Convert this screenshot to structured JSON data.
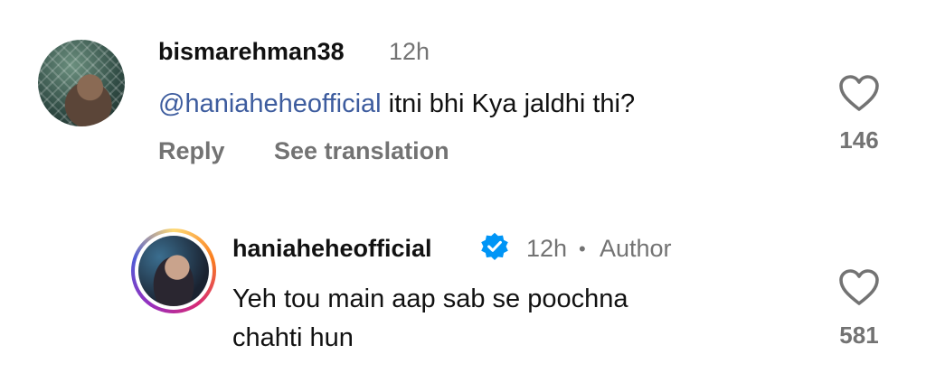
{
  "comment1": {
    "username": "bismarehman38",
    "time": "12h",
    "mention": "@haniaheheofficial",
    "text": "itni bhi Kya jaldhi thi?",
    "reply_label": "Reply",
    "translate_label": "See translation",
    "likes": "146"
  },
  "comment2": {
    "username": "haniaheheofficial",
    "time": "12h",
    "separator": "•",
    "author_label": "Author",
    "text_line1": "Yeh tou main aap sab se poochna",
    "text_line2": "chahti hun",
    "likes": "581"
  },
  "colors": {
    "mention": "#3d5c9e",
    "verified": "#0095f6",
    "muted": "#737373"
  }
}
